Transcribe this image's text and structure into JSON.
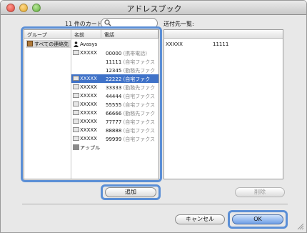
{
  "window": {
    "title": "アドレスブック"
  },
  "toolbar": {
    "count_label": "11 件のカード",
    "search_value": ""
  },
  "left_pane": {
    "headers": {
      "group": "グループ",
      "name": "名前",
      "phone": "電話"
    },
    "group_item": "すべての連絡先",
    "rows": [
      {
        "type": "person",
        "name": "Avasys",
        "number": "",
        "kind": "",
        "selected": false
      },
      {
        "type": "card",
        "name": "XXXXX",
        "number": "00000",
        "kind": "(携帯電話)",
        "selected": false
      },
      {
        "type": "blank",
        "name": "",
        "number": "11111",
        "kind": "(自宅ファクス",
        "selected": false
      },
      {
        "type": "blank",
        "name": "",
        "number": "12345",
        "kind": "(勤務先ファク",
        "selected": false
      },
      {
        "type": "card",
        "name": "XXXXX",
        "number": "22222",
        "kind": "(自宅ファク",
        "selected": true
      },
      {
        "type": "card",
        "name": "XXXXX",
        "number": "33333",
        "kind": "(勤務先ファク",
        "selected": false
      },
      {
        "type": "card",
        "name": "XXXXX",
        "number": "44444",
        "kind": "(自宅ファクス",
        "selected": false
      },
      {
        "type": "card",
        "name": "XXXXX",
        "number": "55555",
        "kind": "(自宅ファクス",
        "selected": false
      },
      {
        "type": "card",
        "name": "XXXXX",
        "number": "66666",
        "kind": "(勤務先ファク",
        "selected": false
      },
      {
        "type": "card",
        "name": "XXXXX",
        "number": "77777",
        "kind": "(自宅ファクス",
        "selected": false
      },
      {
        "type": "card",
        "name": "XXXXX",
        "number": "88888",
        "kind": "(自宅ファクス",
        "selected": false
      },
      {
        "type": "card",
        "name": "XXXXX",
        "number": "99999",
        "kind": "(自宅ファクス",
        "selected": false
      },
      {
        "type": "building",
        "name": "アップル",
        "number": "",
        "kind": "",
        "selected": false
      }
    ]
  },
  "right_pane": {
    "label": "送付先一覧:",
    "rows": [
      {
        "name": "XXXXX",
        "number": "11111"
      }
    ]
  },
  "buttons": {
    "add": "追加",
    "delete": "削除",
    "cancel": "キャンセル",
    "ok": "OK"
  },
  "colors": {
    "highlight": "#5b8fd6",
    "selection": "#3f72c8"
  }
}
